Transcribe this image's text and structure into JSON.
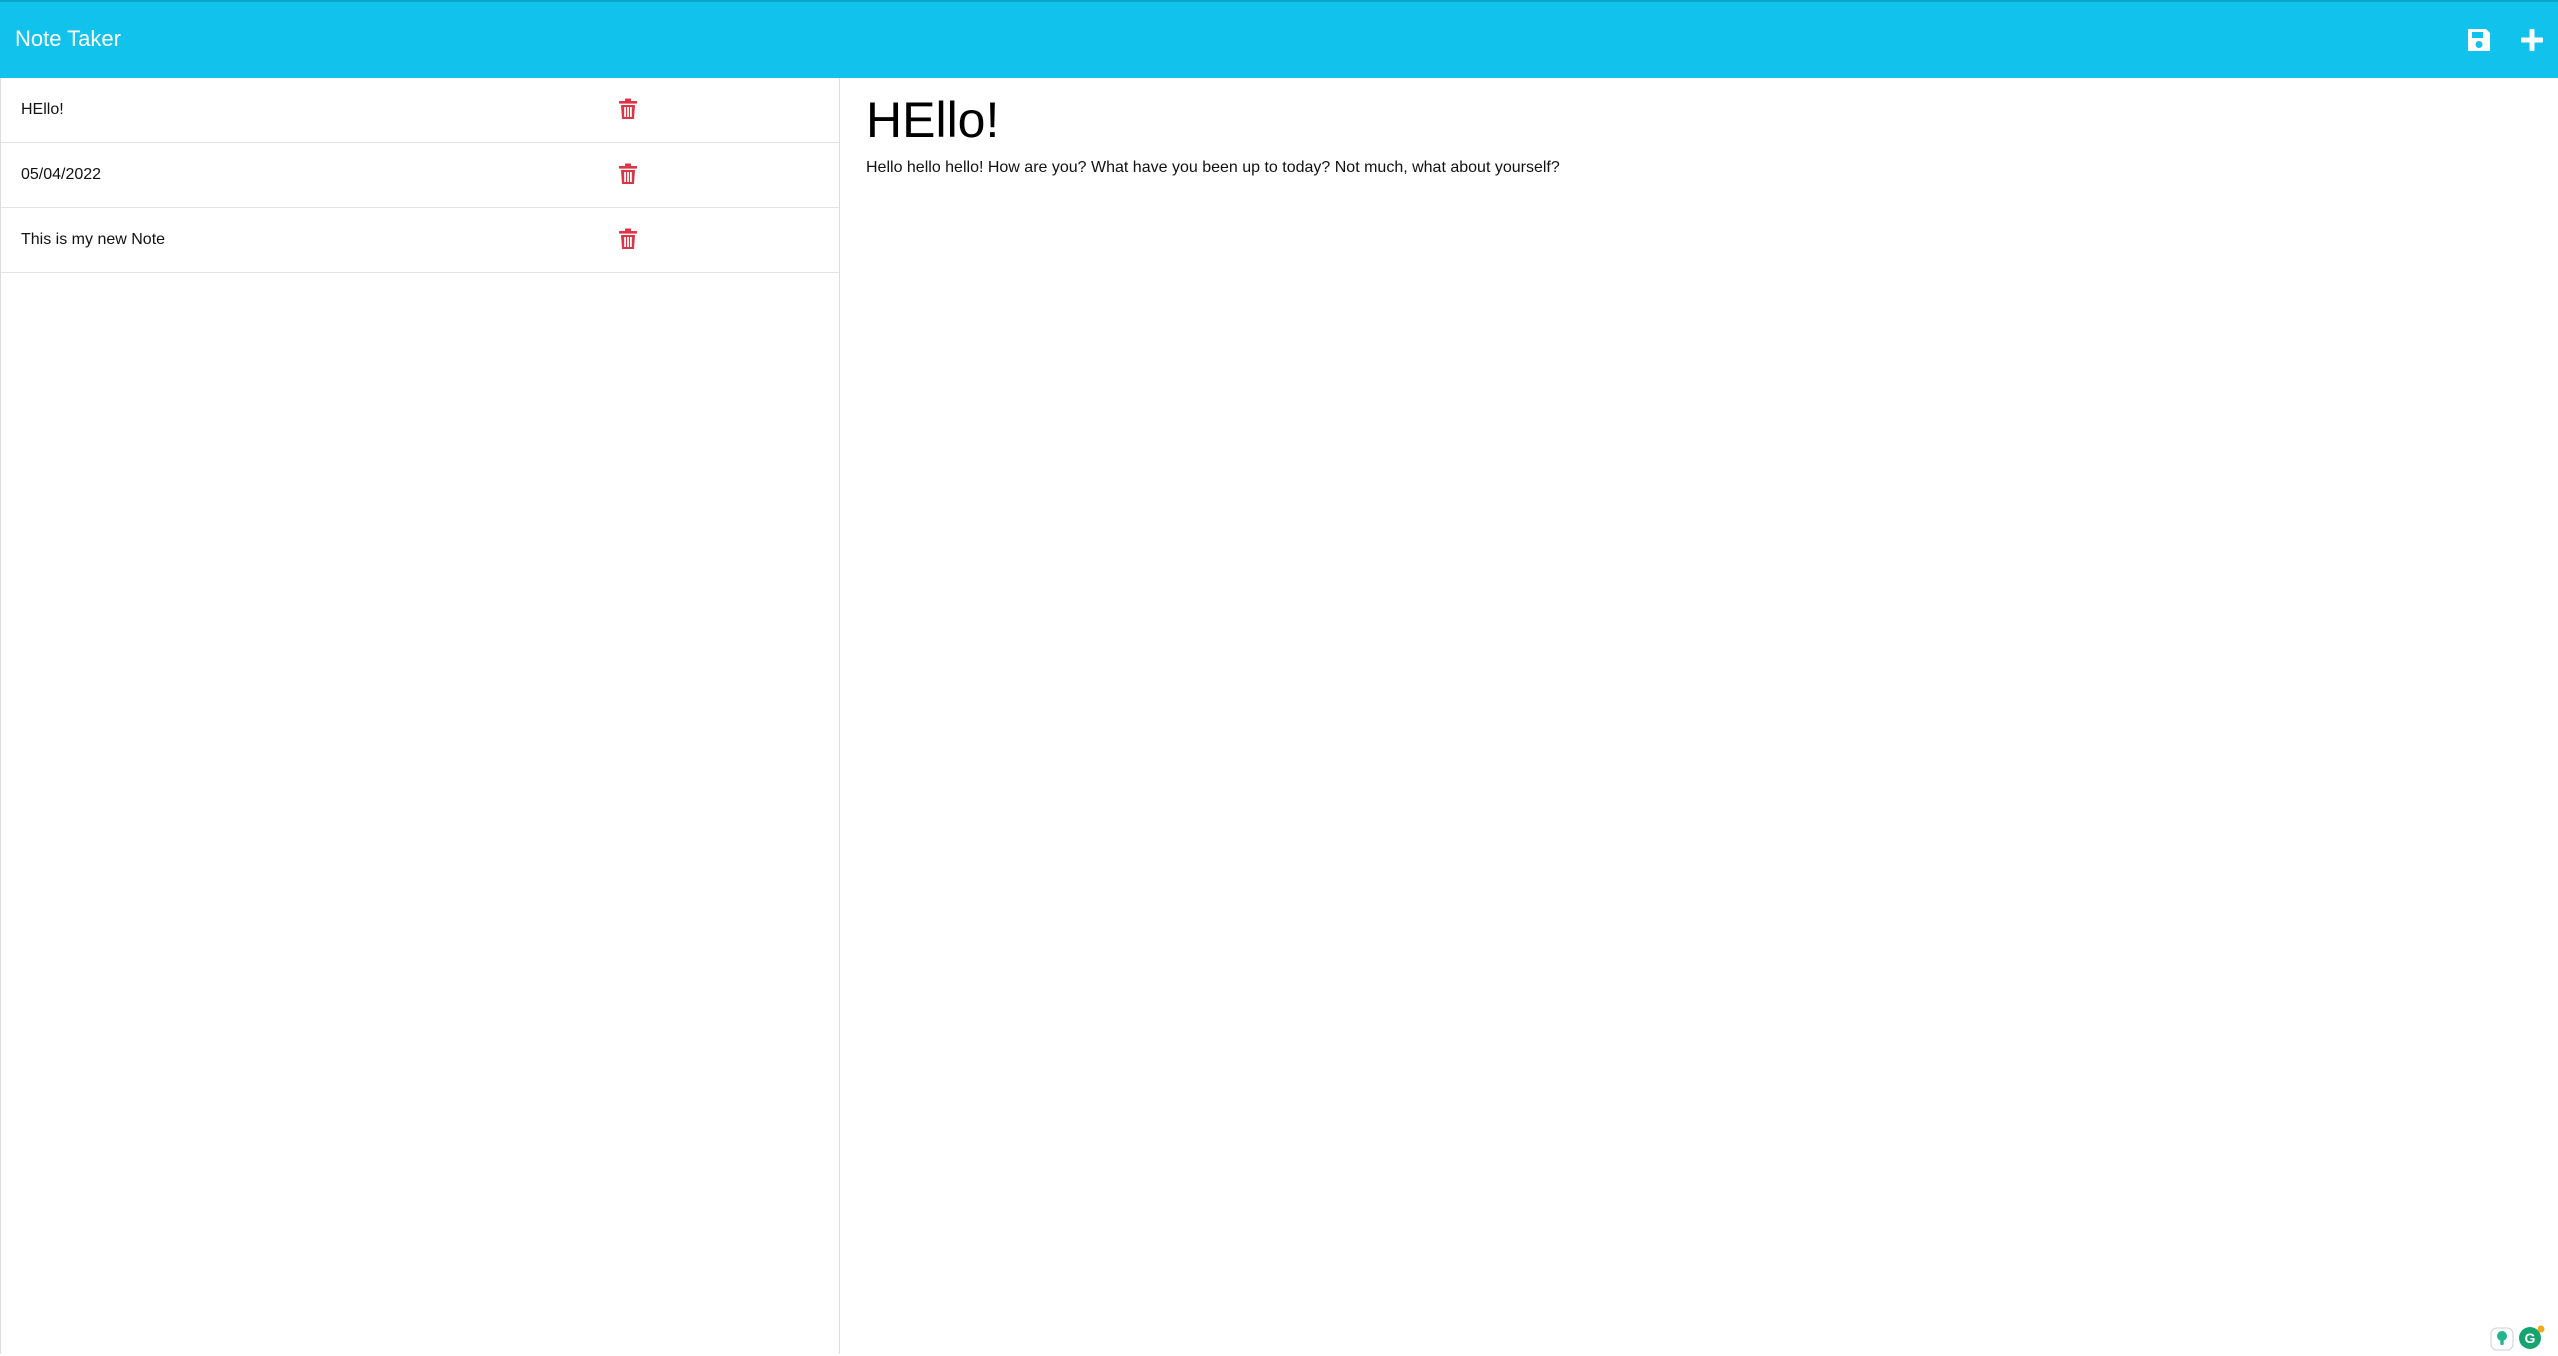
{
  "app": {
    "title": "Note Taker"
  },
  "toolbar": {
    "save_icon": "floppy-disk-icon",
    "new_icon": "plus-icon"
  },
  "notes": [
    {
      "title": "HEllo!",
      "delete_icon": "trash-icon"
    },
    {
      "title": "05/04/2022",
      "delete_icon": "trash-icon"
    },
    {
      "title": "This is my new Note",
      "delete_icon": "trash-icon"
    }
  ],
  "active_note": {
    "title": "HEllo!",
    "text": "Hello hello hello! How are you? What have you been up to today? Not much, what about yourself?"
  },
  "colors": {
    "navbar": "#11c2ec",
    "delete": "#dc3545"
  }
}
